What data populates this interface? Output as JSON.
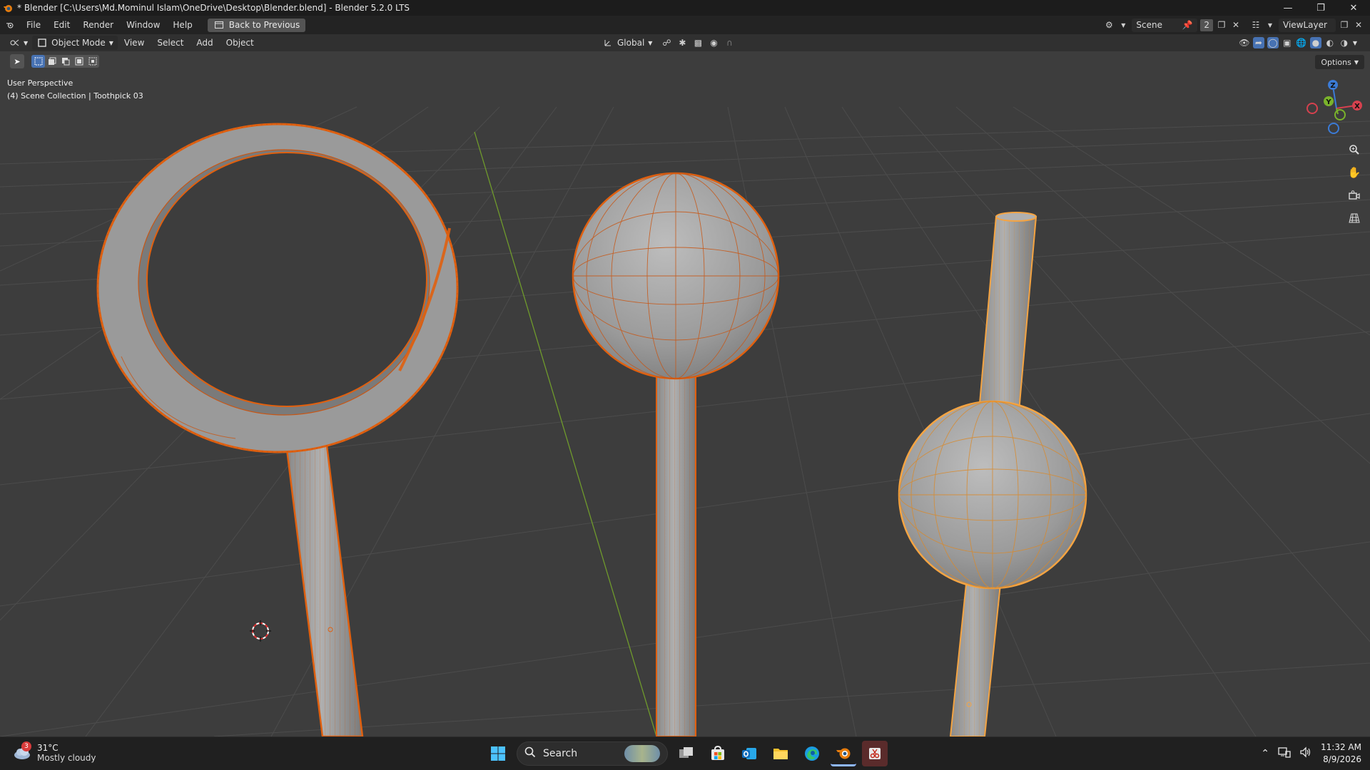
{
  "titlebar": {
    "title": "* Blender [C:\\Users\\Md.Mominul Islam\\OneDrive\\Desktop\\Blender.blend] - Blender 5.2.0 LTS"
  },
  "menu": {
    "items": [
      "File",
      "Edit",
      "Render",
      "Window",
      "Help"
    ],
    "back_button": "Back to Previous"
  },
  "topbar_right": {
    "scene": "Scene",
    "scene_users": "2",
    "view_layer": "ViewLayer"
  },
  "header": {
    "mode": "Object Mode",
    "menus": [
      "View",
      "Select",
      "Add",
      "Object"
    ],
    "transform_orientation": "Global"
  },
  "toolrow": {
    "options": "Options"
  },
  "viewport": {
    "perspective": "User Perspective",
    "collection_info": "(4) Scene Collection | Toothpick 03"
  },
  "gizmo": {
    "x": "X",
    "y": "Y",
    "z": "Z"
  },
  "colors": {
    "selected_outline": "#e0600f",
    "active_outline": "#f5a442",
    "mesh_fill": "#9a9a9a",
    "grid": "#4a4a4a",
    "y_axis": "#7aa52d",
    "accent": "#4772b3"
  },
  "taskbar": {
    "weather_temp": "31°C",
    "weather_desc": "Mostly cloudy",
    "weather_badge": "3",
    "search_placeholder": "Search",
    "time": "11:32 AM",
    "date": "8/9/2026"
  }
}
